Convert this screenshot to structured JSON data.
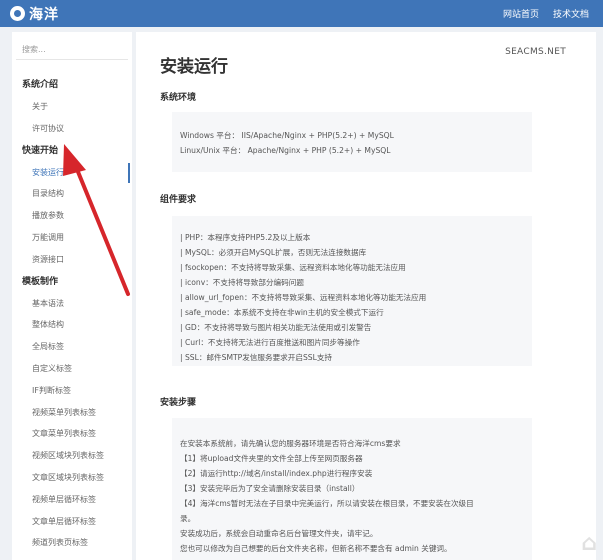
{
  "header": {
    "logo_text": "海洋",
    "nav": [
      "网站首页",
      "技术文档"
    ]
  },
  "sidebar": {
    "search_placeholder": "搜索...",
    "groups": [
      {
        "label": "系统介绍",
        "items": [
          "关于",
          "许可协议"
        ]
      },
      {
        "label": "快速开始",
        "items": [
          "安装运行",
          "目录结构",
          "播放参数",
          "万能调用",
          "资源接口"
        ]
      },
      {
        "label": "模板制作",
        "items": [
          "基本语法",
          "整体结构",
          "全局标签",
          "自定义标签",
          "IF判断标签",
          "视频菜单列表标签",
          "文章菜单列表标签",
          "视频区域块列表标签",
          "文章区域块列表标签",
          "视频单层循环标签",
          "文章单层循环标签",
          "频道列表页标签"
        ]
      }
    ],
    "active_item": "安装运行"
  },
  "content": {
    "brand": "SEACMS.NET",
    "title": "安装运行",
    "sections": [
      {
        "title": "系统环境",
        "lines": [
          "Windows 平台： IIS/Apache/Nginx + PHP(5.2+) + MySQL",
          "Linux/Unix 平台： Apache/Nginx + PHP (5.2+) + MySQL"
        ]
      },
      {
        "title": "组件要求",
        "lines": [
          "| PHP：本程序支持PHP5.2及以上版本",
          "| MySQL：必须开启MySQL扩展，否则无法连接数据库",
          "| fsockopen：不支持将导致采集、远程资料本地化等功能无法应用",
          "| iconv：不支持将导致部分编码问题",
          "| allow_url_fopen：不支持将导致采集、远程资料本地化等功能无法应用",
          "| safe_mode：本系统不支持在非win主机的安全模式下运行",
          "| GD：不支持将导致与图片相关功能无法使用或引发警告",
          "| Curl：不支持将无法进行百度推送和图片同步等操作",
          "| SSL：邮件SMTP发信服务要求开启SSL支持"
        ]
      },
      {
        "title": "安装步骤",
        "lines": [
          "在安装本系统前，请先确认您的服务器环境是否符合海洋cms要求",
          "【1】将upload文件夹里的文件全部上传至网页服务器",
          "【2】请运行http://域名/install/index.php进行程序安装",
          "【3】安装完毕后为了安全请删除安装目录（install）",
          "【4】海洋cms暂时无法在子目录中完美运行，所以请安装在根目录，不要安装在次级目",
          "录。",
          "安装成功后，系统会自动重命名后台管理文件夹，请牢记。",
          "您也可以修改为自己想要的后台文件夹名称，但新名称不要含有 admin 关键词。"
        ]
      }
    ]
  },
  "colors": {
    "header_bg": "#3f75b8",
    "accent": "#3f75b8",
    "arrow": "#d6262b"
  },
  "icons": {
    "logo": "seacms-logo-icon",
    "annotation_arrow": "red-arrow-icon",
    "watermark": "watermark-logo-icon"
  }
}
